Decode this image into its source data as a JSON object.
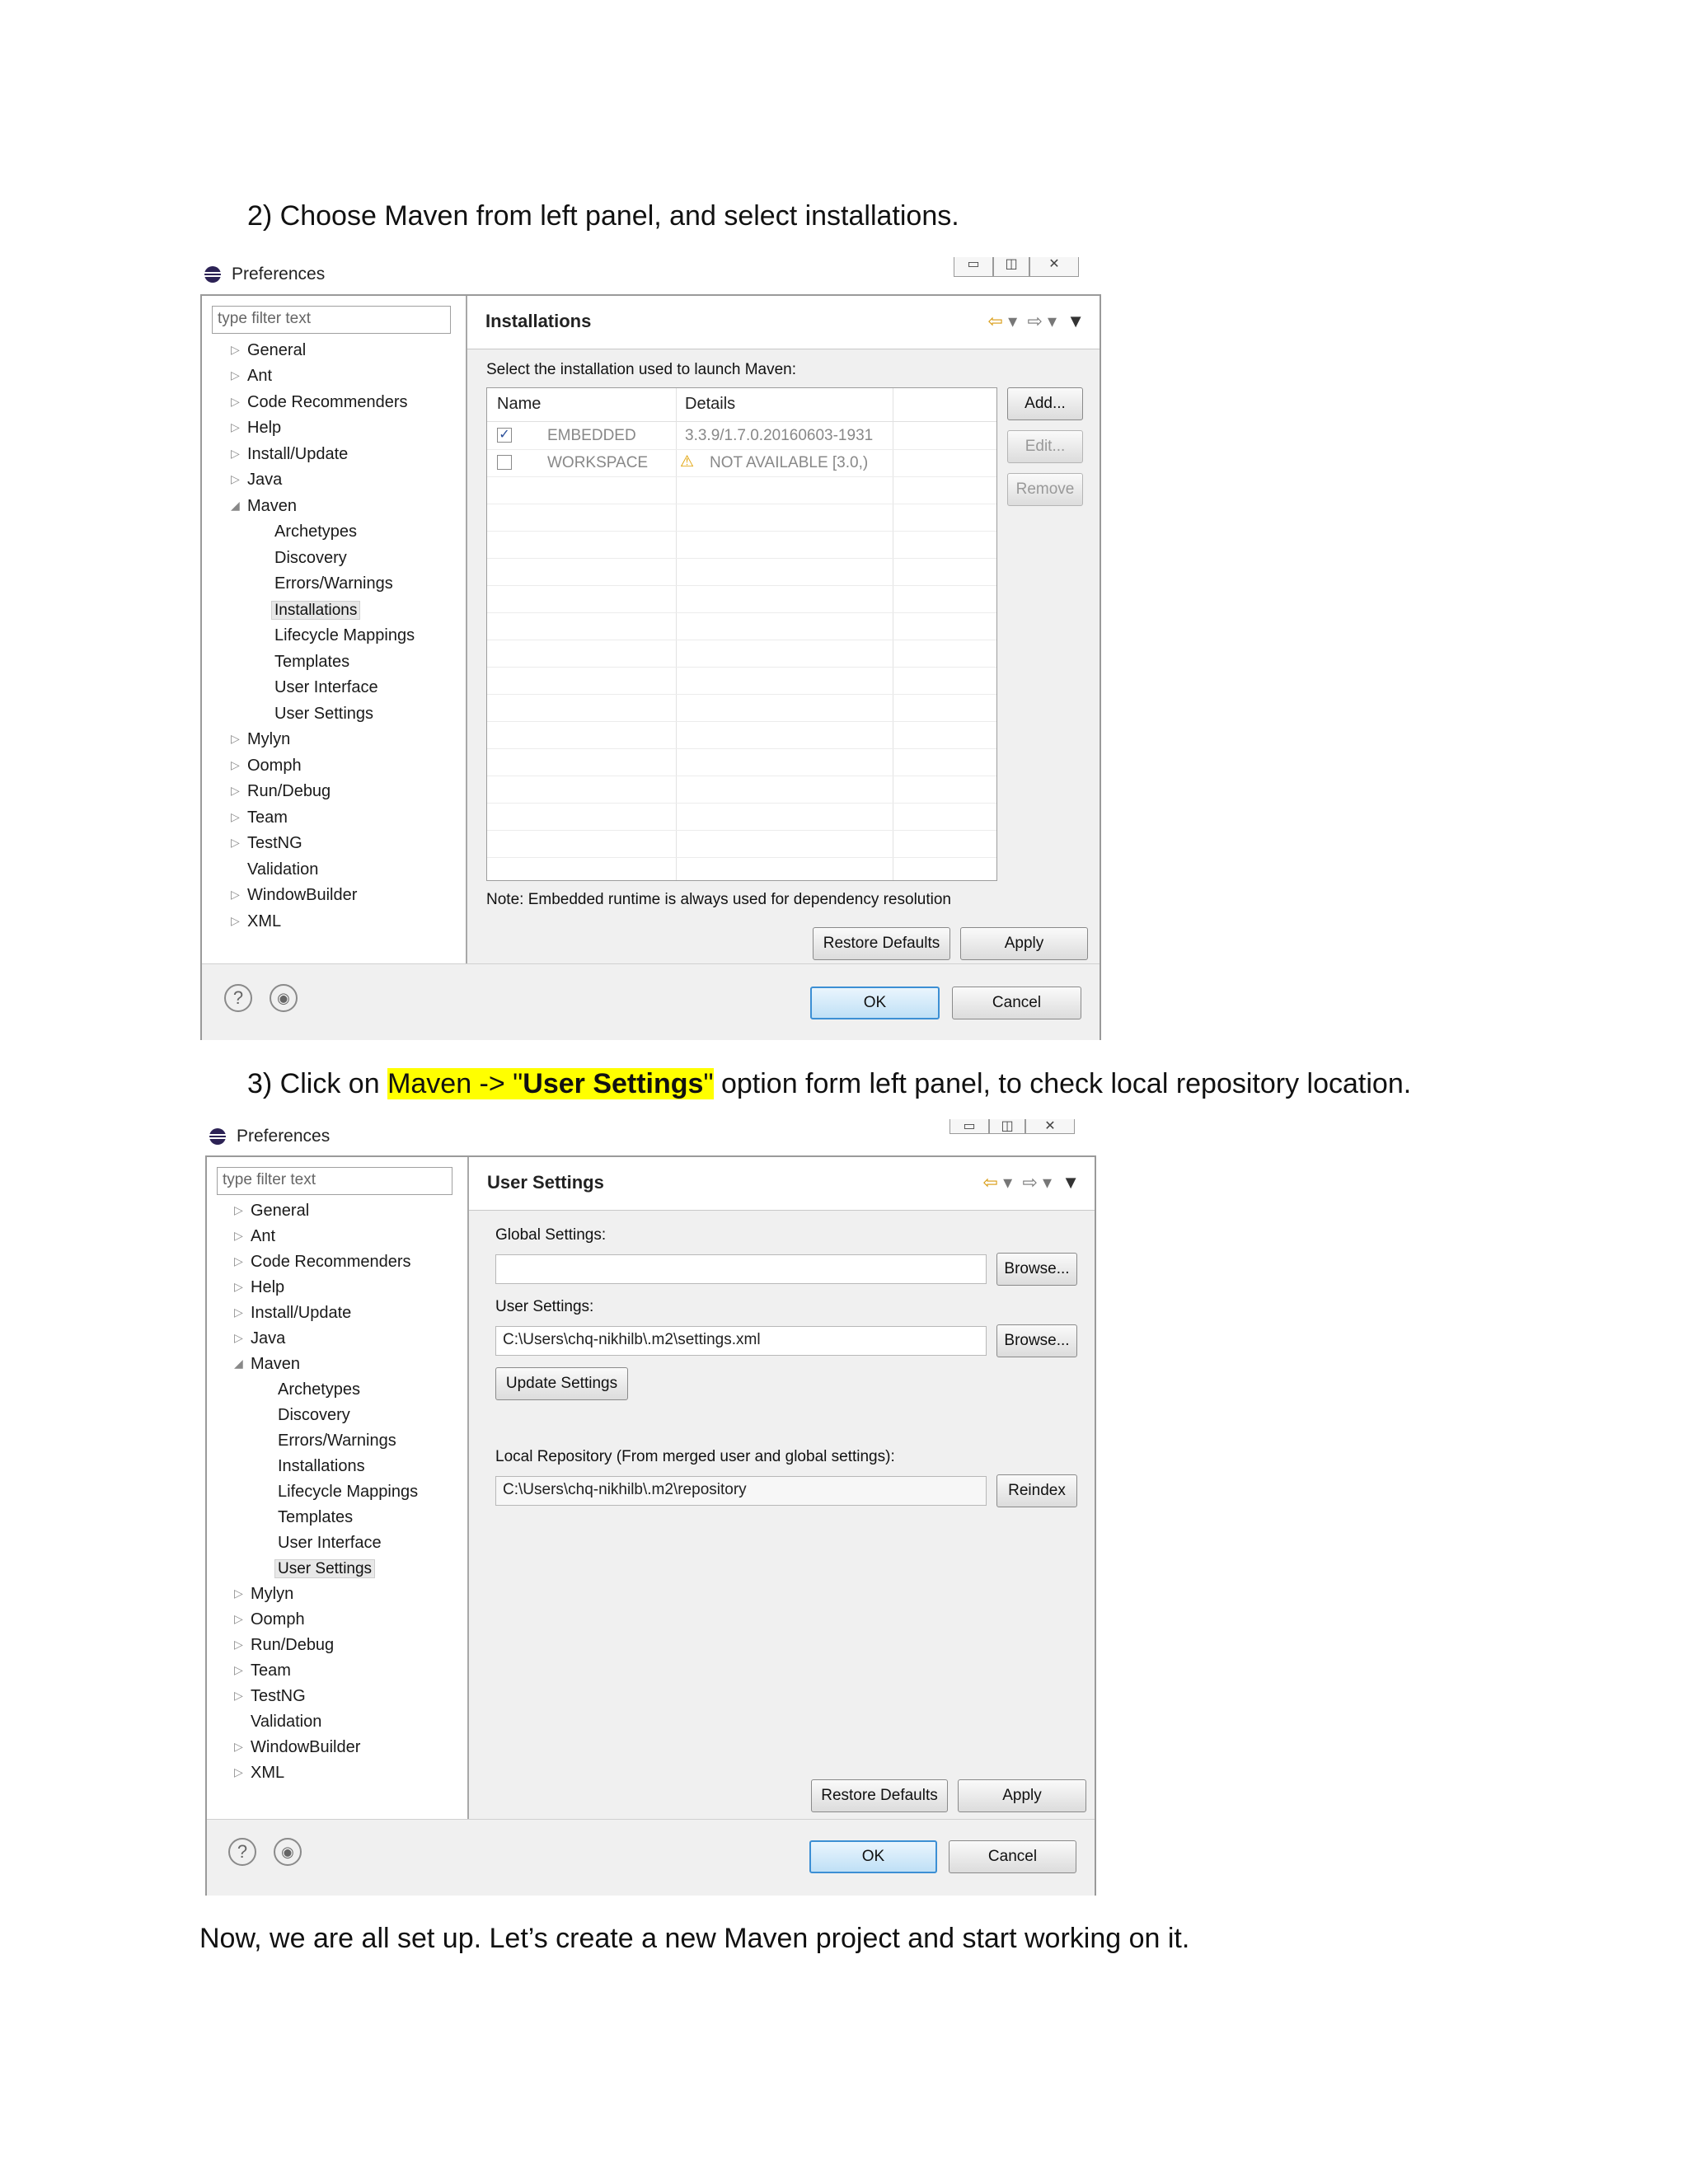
{
  "step2_text": "2) Choose Maven from left panel, and select installations.",
  "step3": {
    "prefix": "3) Click on ",
    "hl1": "Maven -> \"",
    "hl_bold": "User Settings",
    "hl2": "\"",
    "suffix": " option form left panel, to check local repository location."
  },
  "closing_text": "Now, we are all set up. Let’s create a new Maven project and start working on it.",
  "dialog": {
    "title": "Preferences",
    "filter_placeholder": "type filter text",
    "minimize": "▭",
    "maximize": "◫",
    "close": "✕",
    "tree_top": [
      "General",
      "Ant",
      "Code Recommenders",
      "Help",
      "Install/Update",
      "Java",
      "Maven"
    ],
    "tree_maven": [
      "Archetypes",
      "Discovery",
      "Errors/Warnings",
      "Installations",
      "Lifecycle Mappings",
      "Templates",
      "User Interface",
      "User Settings"
    ],
    "tree_bottom": [
      "Mylyn",
      "Oomph",
      "Run/Debug",
      "Team",
      "TestNG",
      "Validation",
      "WindowBuilder",
      "XML"
    ],
    "restore_defaults": "Restore Defaults",
    "apply": "Apply",
    "ok": "OK",
    "cancel": "Cancel",
    "help_icon": "?",
    "prefs_icon": "◉"
  },
  "installations": {
    "header": "Installations",
    "intro": "Select the installation used to launch Maven:",
    "columns": [
      "Name",
      "Details"
    ],
    "rows": [
      {
        "checked": true,
        "name": "EMBEDDED",
        "details": "3.3.9/1.7.0.20160603-1931",
        "warning": false
      },
      {
        "checked": false,
        "name": "WORKSPACE",
        "details": "NOT AVAILABLE [3.0,)",
        "warning": true
      }
    ],
    "add": "Add...",
    "edit": "Edit...",
    "remove": "Remove",
    "note": "Note: Embedded runtime is always used for dependency resolution"
  },
  "user_settings": {
    "header": "User Settings",
    "global_label": "Global Settings:",
    "global_value": "",
    "browse": "Browse...",
    "user_label": "User Settings:",
    "user_value": "C:\\Users\\chq-nikhilb\\.m2\\settings.xml",
    "update": "Update Settings",
    "local_label": "Local Repository (From merged user and global settings):",
    "local_value": "C:\\Users\\chq-nikhilb\\.m2\\repository",
    "reindex": "Reindex"
  },
  "colors": {
    "highlight": "#ffff00",
    "back_arrow": "#d89a10",
    "ok_border": "#3c8fd4"
  }
}
